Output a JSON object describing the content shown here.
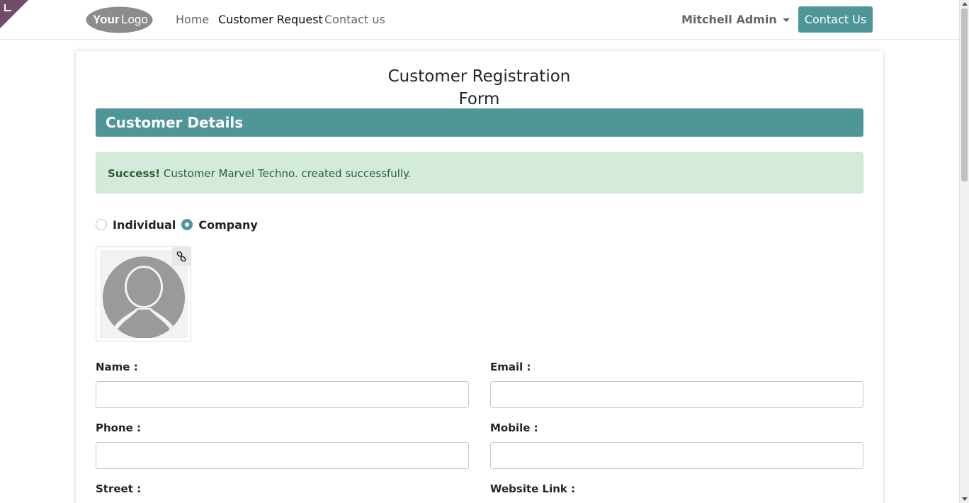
{
  "nav": {
    "logo_text": "YourLogo",
    "links": [
      "Home",
      "Customer Request",
      "Contact us"
    ],
    "active_index": 1,
    "user_name": "Mitchell Admin",
    "contact_button": "Contact Us"
  },
  "form": {
    "title": "Customer Registration Form",
    "section_title": "Customer Details",
    "alert": {
      "strong": "Success!",
      "message": "Customer Marvel Techno. created successfully."
    },
    "customer_type": {
      "options": [
        "Individual",
        "Company"
      ],
      "selected": "Company"
    },
    "fields": {
      "name_label": "Name :",
      "email_label": "Email :",
      "phone_label": "Phone :",
      "mobile_label": "Mobile :",
      "street_label": "Street :",
      "website_label": "Website Link :",
      "name_value": "",
      "email_value": "",
      "phone_value": "",
      "mobile_value": ""
    }
  },
  "colors": {
    "accent": "#4e9698",
    "ribbon": "#714b67",
    "alert_bg": "#d4ebdb",
    "alert_text": "#2a5f36"
  }
}
